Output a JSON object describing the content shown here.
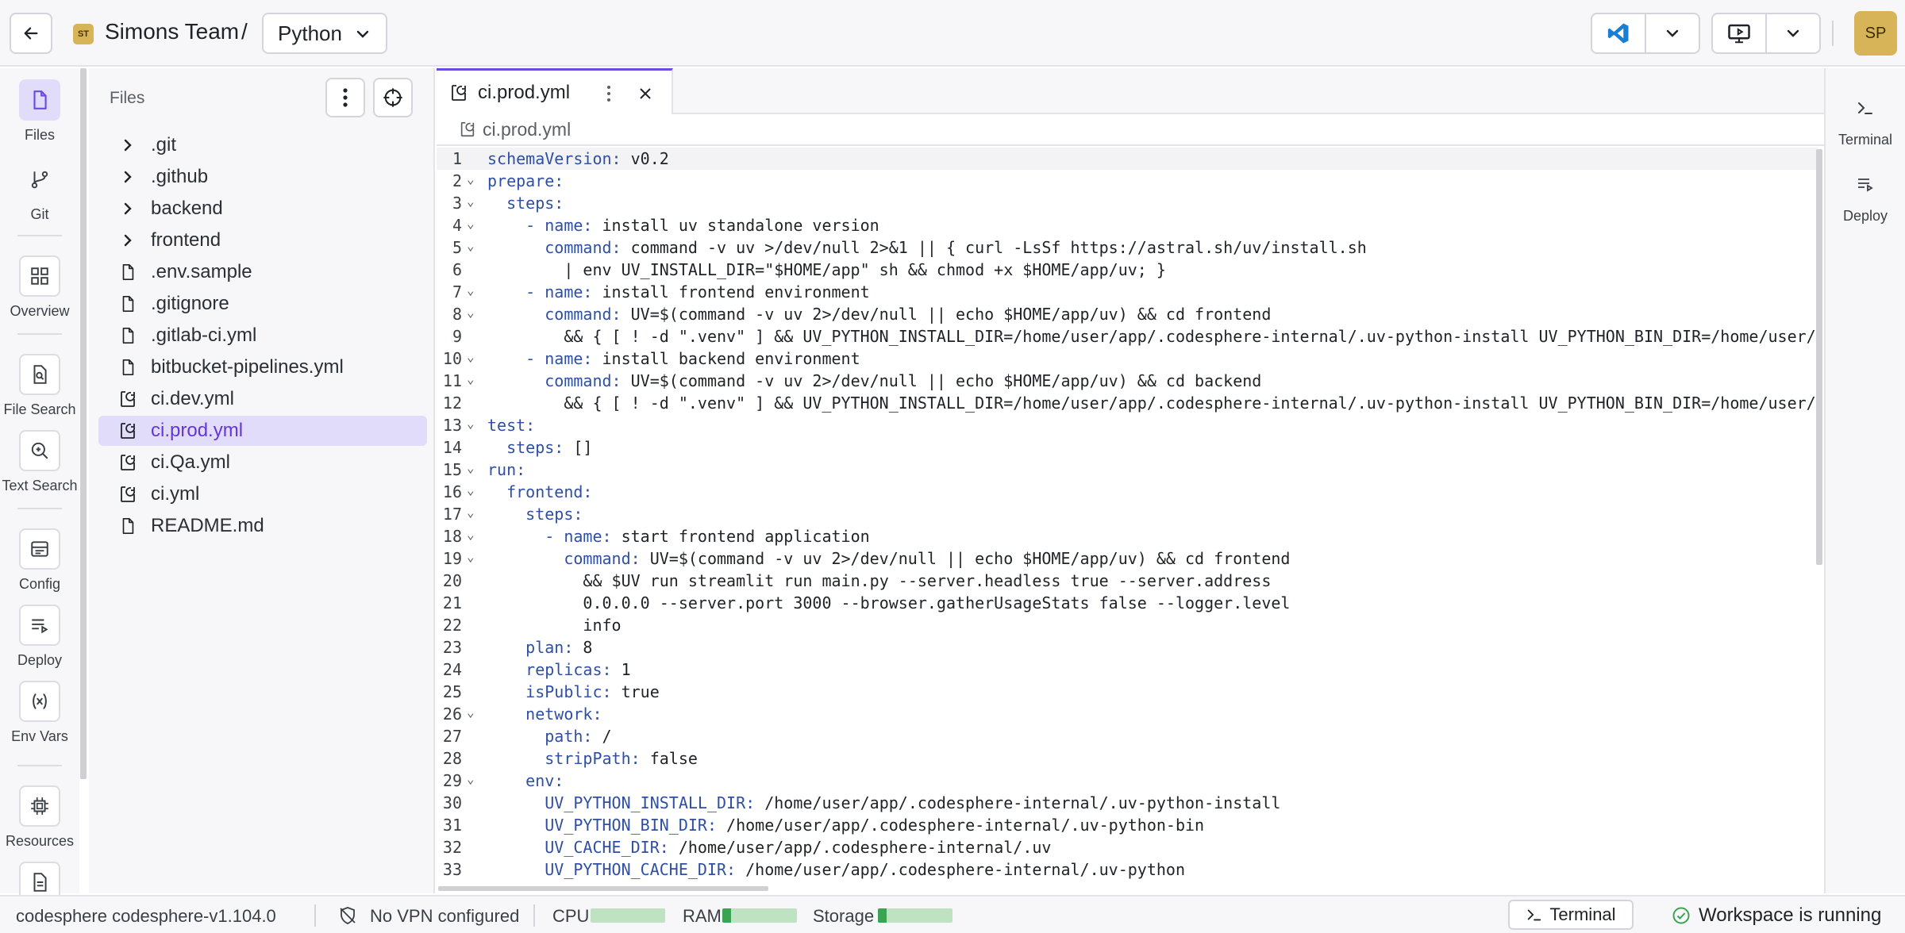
{
  "header": {
    "team_badge": "ST",
    "team_name": "Simons Team",
    "separator": "/",
    "project": "Python",
    "user_initials": "SP"
  },
  "left_activity": [
    {
      "label": "Files",
      "icon": "file-icon"
    },
    {
      "label": "Git",
      "icon": "git-branch-icon"
    },
    {
      "label": "Overview",
      "icon": "dashboard-icon"
    },
    {
      "label": "File Search",
      "icon": "file-search-icon"
    },
    {
      "label": "Text Search",
      "icon": "text-search-icon"
    },
    {
      "label": "Config",
      "icon": "config-icon"
    },
    {
      "label": "Deploy",
      "icon": "deploy-icon"
    },
    {
      "label": "Env Vars",
      "icon": "variable-icon"
    },
    {
      "label": "Resources",
      "icon": "chip-icon"
    }
  ],
  "explorer": {
    "title": "Files",
    "items": [
      {
        "label": ".git",
        "kind": "folder"
      },
      {
        "label": ".github",
        "kind": "folder"
      },
      {
        "label": "backend",
        "kind": "folder"
      },
      {
        "label": "frontend",
        "kind": "folder"
      },
      {
        "label": ".env.sample",
        "kind": "file"
      },
      {
        "label": ".gitignore",
        "kind": "file"
      },
      {
        "label": ".gitlab-ci.yml",
        "kind": "file"
      },
      {
        "label": "bitbucket-pipelines.yml",
        "kind": "file"
      },
      {
        "label": "ci.dev.yml",
        "kind": "ci"
      },
      {
        "label": "ci.prod.yml",
        "kind": "ci",
        "selected": true
      },
      {
        "label": "ci.Qa.yml",
        "kind": "ci"
      },
      {
        "label": "ci.yml",
        "kind": "ci"
      },
      {
        "label": "README.md",
        "kind": "file"
      }
    ]
  },
  "editor": {
    "tab_label": "ci.prod.yml",
    "breadcrumb": "ci.prod.yml",
    "lines": [
      {
        "n": "1",
        "fold": false,
        "indent": "",
        "key": "schemaVersion:",
        "val": " v0.2"
      },
      {
        "n": "2",
        "fold": true,
        "indent": "",
        "key": "prepare:",
        "val": ""
      },
      {
        "n": "3",
        "fold": true,
        "indent": "  ",
        "key": "steps:",
        "val": ""
      },
      {
        "n": "4",
        "fold": true,
        "indent": "    ",
        "key": "- name:",
        "val": " install uv standalone version"
      },
      {
        "n": "5",
        "fold": true,
        "indent": "      ",
        "key": "command:",
        "val": " command -v uv >/dev/null 2>&1 || { curl -LsSf https://astral.sh/uv/install.sh"
      },
      {
        "n": "6",
        "fold": false,
        "indent": "        ",
        "key": "",
        "val": "| env UV_INSTALL_DIR=\"$HOME/app\" sh && chmod +x $HOME/app/uv; }"
      },
      {
        "n": "7",
        "fold": true,
        "indent": "    ",
        "key": "- name:",
        "val": " install frontend environment"
      },
      {
        "n": "8",
        "fold": true,
        "indent": "      ",
        "key": "command:",
        "val": " UV=$(command -v uv 2>/dev/null || echo $HOME/app/uv) && cd frontend"
      },
      {
        "n": "9",
        "fold": false,
        "indent": "        ",
        "key": "",
        "val": "&& { [ ! -d \".venv\" ] && UV_PYTHON_INSTALL_DIR=/home/user/app/.codesphere-internal/.uv-python-install UV_PYTHON_BIN_DIR=/home/user/"
      },
      {
        "n": "10",
        "fold": true,
        "indent": "    ",
        "key": "- name:",
        "val": " install backend environment"
      },
      {
        "n": "11",
        "fold": true,
        "indent": "      ",
        "key": "command:",
        "val": " UV=$(command -v uv 2>/dev/null || echo $HOME/app/uv) && cd backend"
      },
      {
        "n": "12",
        "fold": false,
        "indent": "        ",
        "key": "",
        "val": "&& { [ ! -d \".venv\" ] && UV_PYTHON_INSTALL_DIR=/home/user/app/.codesphere-internal/.uv-python-install UV_PYTHON_BIN_DIR=/home/user/"
      },
      {
        "n": "13",
        "fold": true,
        "indent": "",
        "key": "test:",
        "val": ""
      },
      {
        "n": "14",
        "fold": false,
        "indent": "  ",
        "key": "steps:",
        "val": " []"
      },
      {
        "n": "15",
        "fold": true,
        "indent": "",
        "key": "run:",
        "val": ""
      },
      {
        "n": "16",
        "fold": true,
        "indent": "  ",
        "key": "frontend:",
        "val": ""
      },
      {
        "n": "17",
        "fold": true,
        "indent": "    ",
        "key": "steps:",
        "val": ""
      },
      {
        "n": "18",
        "fold": true,
        "indent": "      ",
        "key": "- name:",
        "val": " start frontend application"
      },
      {
        "n": "19",
        "fold": true,
        "indent": "        ",
        "key": "command:",
        "val": " UV=$(command -v uv 2>/dev/null || echo $HOME/app/uv) && cd frontend"
      },
      {
        "n": "20",
        "fold": false,
        "indent": "          ",
        "key": "",
        "val": "&& $UV run streamlit run main.py --server.headless true --server.address"
      },
      {
        "n": "21",
        "fold": false,
        "indent": "          ",
        "key": "",
        "val": "0.0.0.0 --server.port 3000 --browser.gatherUsageStats false --logger.level"
      },
      {
        "n": "22",
        "fold": false,
        "indent": "          ",
        "key": "",
        "val": "info"
      },
      {
        "n": "23",
        "fold": false,
        "indent": "    ",
        "key": "plan:",
        "val": " 8"
      },
      {
        "n": "24",
        "fold": false,
        "indent": "    ",
        "key": "replicas:",
        "val": " 1"
      },
      {
        "n": "25",
        "fold": false,
        "indent": "    ",
        "key": "isPublic:",
        "val": " true"
      },
      {
        "n": "26",
        "fold": true,
        "indent": "    ",
        "key": "network:",
        "val": ""
      },
      {
        "n": "27",
        "fold": false,
        "indent": "      ",
        "key": "path:",
        "val": " /"
      },
      {
        "n": "28",
        "fold": false,
        "indent": "      ",
        "key": "stripPath:",
        "val": " false"
      },
      {
        "n": "29",
        "fold": true,
        "indent": "    ",
        "key": "env:",
        "val": ""
      },
      {
        "n": "30",
        "fold": false,
        "indent": "      ",
        "key": "UV_PYTHON_INSTALL_DIR:",
        "val": " /home/user/app/.codesphere-internal/.uv-python-install"
      },
      {
        "n": "31",
        "fold": false,
        "indent": "      ",
        "key": "UV_PYTHON_BIN_DIR:",
        "val": " /home/user/app/.codesphere-internal/.uv-python-bin"
      },
      {
        "n": "32",
        "fold": false,
        "indent": "      ",
        "key": "UV_CACHE_DIR:",
        "val": " /home/user/app/.codesphere-internal/.uv"
      },
      {
        "n": "33",
        "fold": false,
        "indent": "      ",
        "key": "UV_PYTHON_CACHE_DIR:",
        "val": " /home/user/app/.codesphere-internal/.uv-python"
      }
    ]
  },
  "right_activity": [
    {
      "label": "Terminal",
      "icon": "terminal-icon"
    },
    {
      "label": "Deploy",
      "icon": "deploy-icon"
    }
  ],
  "status": {
    "version": "codesphere codesphere-v1.104.0",
    "vpn": "No VPN configured",
    "cpu_label": "CPU",
    "cpu_usage": 0.0,
    "ram_label": "RAM",
    "ram_usage": 0.12,
    "storage_label": "Storage",
    "storage_usage": 0.12,
    "terminal_button": "Terminal",
    "workspace_state": "Workspace is running"
  },
  "colors": {
    "accent": "#6c4ce0",
    "selection": "#e2dcfb",
    "yaml_key": "#2f4fa3",
    "running": "#3aa452",
    "avatar": "#d8b458"
  }
}
